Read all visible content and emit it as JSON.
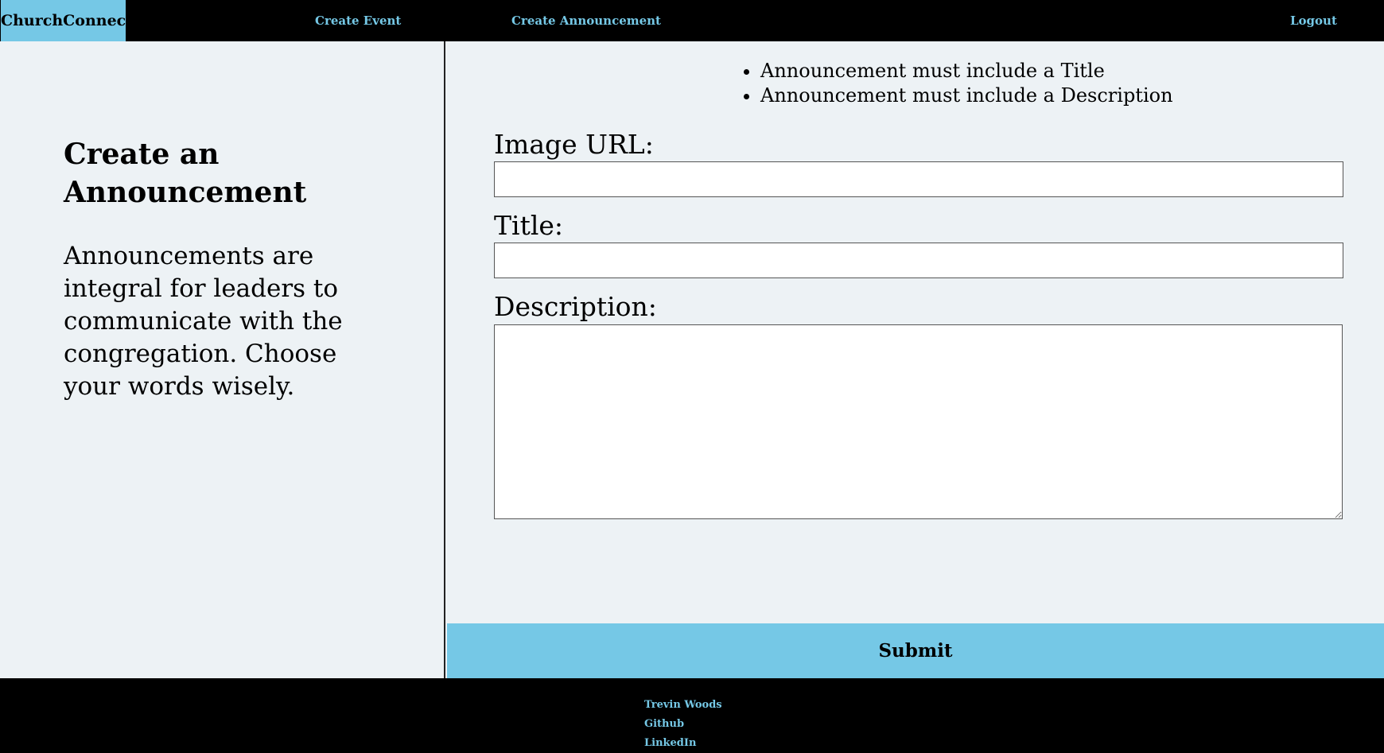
{
  "navbar": {
    "brand": "ChurchConnect",
    "links": {
      "create_event": "Create Event",
      "create_announcement": "Create Announcement",
      "logout": "Logout"
    }
  },
  "sidebar": {
    "title": "Create an Announcement",
    "description": "Announcements are integral for leaders to communicate with the congregation. Choose your words wisely."
  },
  "form": {
    "errors": [
      "Announcement must include a Title",
      "Announcement must include a Description"
    ],
    "image_url": {
      "label": "Image URL:",
      "value": ""
    },
    "title": {
      "label": "Title:",
      "value": ""
    },
    "description": {
      "label": "Description:",
      "value": ""
    },
    "submit_label": "Submit"
  },
  "footer": {
    "author": "Trevin Woods",
    "github": "Github",
    "linkedin": "LinkedIn"
  },
  "colors": {
    "accent": "#75c8e6",
    "background": "#edf2f5",
    "nav_background": "#000000"
  }
}
